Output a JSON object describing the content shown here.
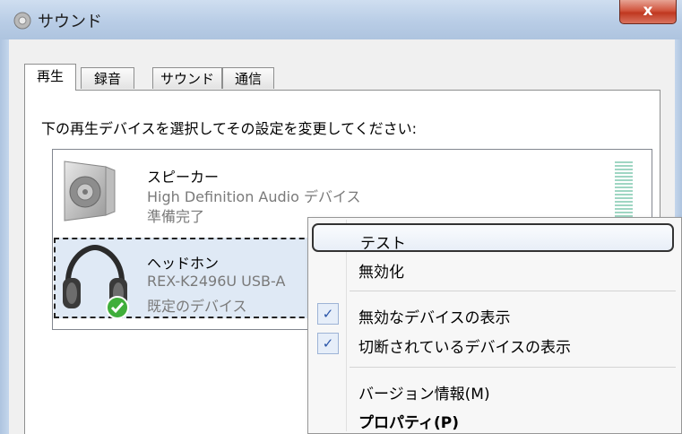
{
  "window": {
    "title": "サウンド",
    "close_label": "x"
  },
  "tabs": [
    {
      "label": "再生",
      "active": true
    },
    {
      "label": "録音",
      "active": false
    },
    {
      "label": "サウンド",
      "active": false
    },
    {
      "label": "通信",
      "active": false
    }
  ],
  "instruction": "下の再生デバイスを選択してその設定を変更してください:",
  "devices": [
    {
      "name": "スピーカー",
      "description": "High Definition Audio デバイス",
      "status": "準備完了",
      "icon": "speaker-icon"
    },
    {
      "name": "ヘッドホン",
      "description": "REX-K2496U USB-A",
      "status": "既定のデバイス",
      "icon": "headphones-icon",
      "selected": true,
      "default": true
    }
  ],
  "context_menu": {
    "items": [
      {
        "label": "テスト",
        "hover": true
      },
      {
        "label": "無効化"
      },
      {
        "label": "無効なデバイスの表示",
        "checked": true
      },
      {
        "label": "切断されているデバイスの表示",
        "checked": true
      },
      {
        "label": "バージョン情報(M)"
      },
      {
        "label": "プロパティ(P)",
        "bold": true
      }
    ],
    "check_glyph": "✓"
  },
  "colors": {
    "accent_selection": "#dfe9f5",
    "title_bar": "#b9cde6",
    "close_button": "#c9452d",
    "meter": "#9fd6c3",
    "default_badge": "#3fae3a"
  }
}
